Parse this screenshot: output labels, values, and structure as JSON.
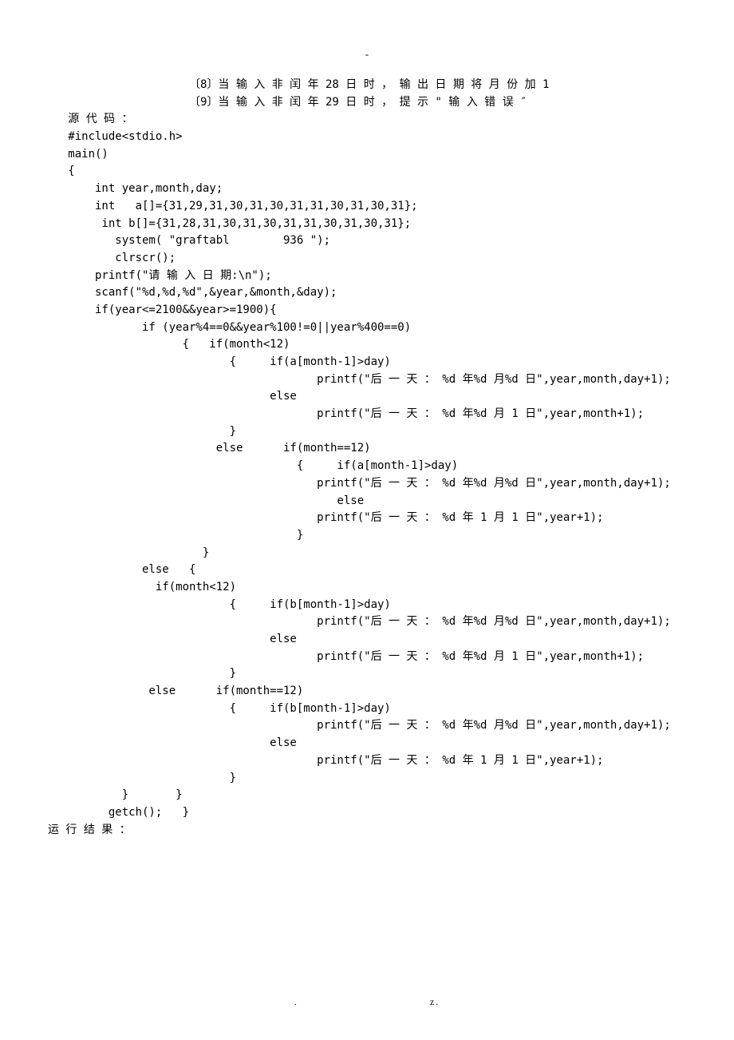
{
  "top_dash": "-",
  "lines": [
    "                     〔8〕当 输 入 非 闰 年 28 日 时 ， 输 出 日 期 将 月 份 加 1",
    "                     〔9〕当 输 入 非 闰 年 29 日 时 ， 提 示 \" 输 入 错 误 ″",
    "   源 代 码 ：",
    "   #include<stdio.h>",
    "   main()",
    "   {",
    "       int year,month,day;",
    "       int   a[]={31,29,31,30,31,30,31,31,30,31,30,31};",
    "        int b[]={31,28,31,30,31,30,31,31,30,31,30,31};",
    "          system( \"graftabl        936 \");",
    "          clrscr();",
    "       printf(\"请 输 入 日 期:\\n\");",
    "       scanf(\"%d,%d,%d\",&year,&month,&day);",
    "       if(year<=2100&&year>=1900){",
    "              if (year%4==0&&year%100!=0||year%400==0)",
    "                    {   if(month<12)",
    "                           {     if(a[month-1]>day)",
    "                                        printf(\"后 一 天 ： %d 年%d 月%d 日\",year,month,day+1);",
    "                                 else",
    "                                        printf(\"后 一 天 ： %d 年%d 月 1 日\",year,month+1);",
    "                           }",
    "                         else      if(month==12)",
    "                                     {     if(a[month-1]>day)",
    "                                        printf(\"后 一 天 ： %d 年%d 月%d 日\",year,month,day+1);",
    "                                           else",
    "                                        printf(\"后 一 天 ： %d 年 1 月 1 日\",year+1);",
    "                                     }",
    "                       }",
    "              else   {",
    "                if(month<12)",
    "                           {     if(b[month-1]>day)",
    "                                        printf(\"后 一 天 ： %d 年%d 月%d 日\",year,month,day+1);",
    "                                 else",
    "                                        printf(\"后 一 天 ： %d 年%d 月 1 日\",year,month+1);",
    "                           }",
    "               else      if(month==12)",
    "                           {     if(b[month-1]>day)",
    "                                        printf(\"后 一 天 ： %d 年%d 月%d 日\",year,month,day+1);",
    "                                 else",
    "                                        printf(\"后 一 天 ： %d 年 1 月 1 日\",year+1);",
    "                           }",
    "           }       }",
    "         getch();   }",
    "运 行 结 果 ："
  ],
  "footer_left": ".",
  "footer_right": "z."
}
